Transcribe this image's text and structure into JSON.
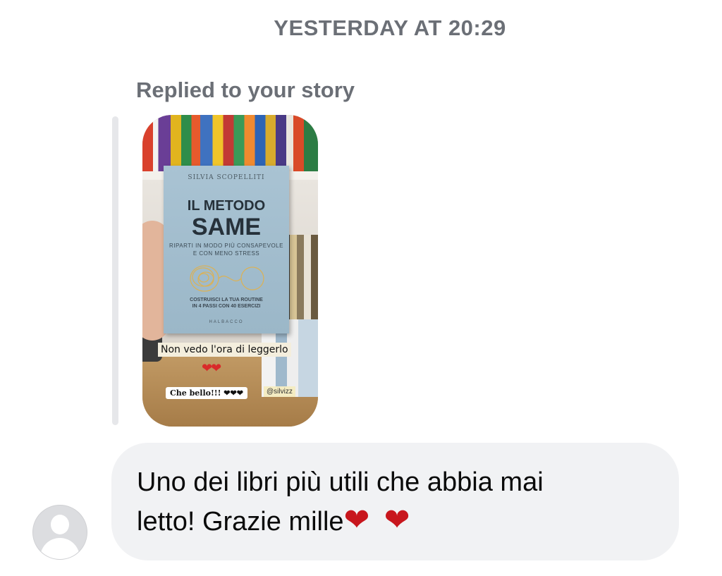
{
  "conversation": {
    "timestamp": "YESTERDAY AT 20:29",
    "reply_label": "Replied to your story"
  },
  "story": {
    "book": {
      "author": "SILVIA SCOPELLITI",
      "title_line1": "IL METODO",
      "title_line2": "SAME",
      "subtitle_line1": "RIPARTI IN MODO PIÙ CONSAPEVOLE",
      "subtitle_line2": "E CON MENO STRESS",
      "footer_line1": "COSTRUISCI LA TUA ROUTINE",
      "footer_line2": "IN 4 PASSI CON 40 ESERCIZI",
      "publisher": "HALBACCO"
    },
    "caption_sticker": "Non vedo l'ora di leggerlo",
    "caption_hearts": "❤❤",
    "reply_sticker": "Che bello!!! ❤❤❤",
    "mention_sticker": "@silvizz"
  },
  "message": {
    "text_line1": "Uno dei libri più utili che abbia mai",
    "text_line2": "letto! Grazie mille",
    "hearts": "❤ ❤"
  },
  "avatar": {
    "icon": "default-avatar-icon"
  },
  "colors": {
    "meta_text": "#6b6f76",
    "bubble_bg": "#f1f2f4",
    "reply_bar": "#e6e7ea",
    "heart": "#c8161d"
  }
}
